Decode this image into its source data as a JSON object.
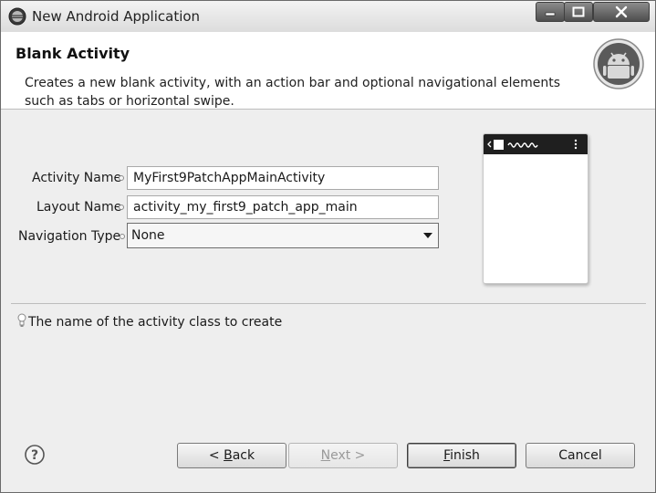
{
  "window": {
    "title": "New Android Application"
  },
  "header": {
    "title": "Blank Activity",
    "description": "Creates a new blank activity, with an action bar and optional navigational elements such as tabs or horizontal swipe."
  },
  "form": {
    "activity_name": {
      "label": "Activity Name",
      "value": "MyFirst9PatchAppMainActivity"
    },
    "layout_name": {
      "label": "Layout Name",
      "value": "activity_my_first9_patch_app_main"
    },
    "navigation_type": {
      "label": "Navigation Type",
      "value": "None"
    }
  },
  "hint": {
    "text": "The name of the activity class to create"
  },
  "buttons": {
    "back": {
      "prefix": "< ",
      "mnemonic": "B",
      "rest": "ack"
    },
    "next": {
      "mnemonic": "N",
      "rest": "ext >"
    },
    "finish": {
      "mnemonic": "F",
      "rest": "inish"
    },
    "cancel": {
      "label": "Cancel"
    }
  },
  "icons": {
    "app": "eclipse-icon",
    "logo": "android-logo-icon",
    "hint": "lightbulb-icon",
    "help": "help-icon",
    "minimize": "minimize-icon",
    "maximize": "maximize-icon",
    "close": "close-icon"
  },
  "colors": {
    "title_button": "#4e4e4e",
    "preview_bar": "#1f1f1f"
  }
}
